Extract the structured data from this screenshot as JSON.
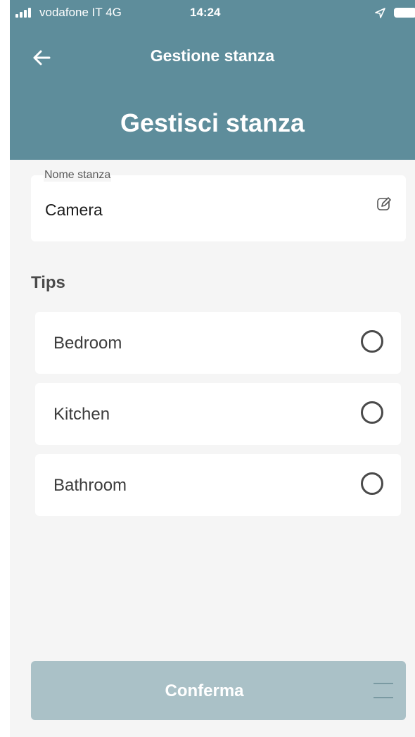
{
  "status_bar": {
    "carrier": "vodafone IT  4G",
    "time": "14:24"
  },
  "header": {
    "nav_title": "Gestione stanza",
    "page_title": "Gestisci stanza"
  },
  "room_name": {
    "label": "Nome stanza",
    "value": "Camera"
  },
  "tips": {
    "heading": "Tips",
    "items": [
      {
        "label": "Bedroom",
        "selected": false
      },
      {
        "label": "Kitchen",
        "selected": false
      },
      {
        "label": "Bathroom",
        "selected": false
      }
    ]
  },
  "footer": {
    "confirm_label": "Conferma"
  },
  "colors": {
    "header": "#5e8d9b",
    "background": "#f5f5f5",
    "confirm_disabled": "#aac1c7"
  },
  "icons": [
    "signal-icon",
    "location-arrow-icon",
    "battery-icon",
    "back-arrow-icon",
    "edit-icon",
    "radio-unchecked-icon",
    "menu-icon"
  ]
}
